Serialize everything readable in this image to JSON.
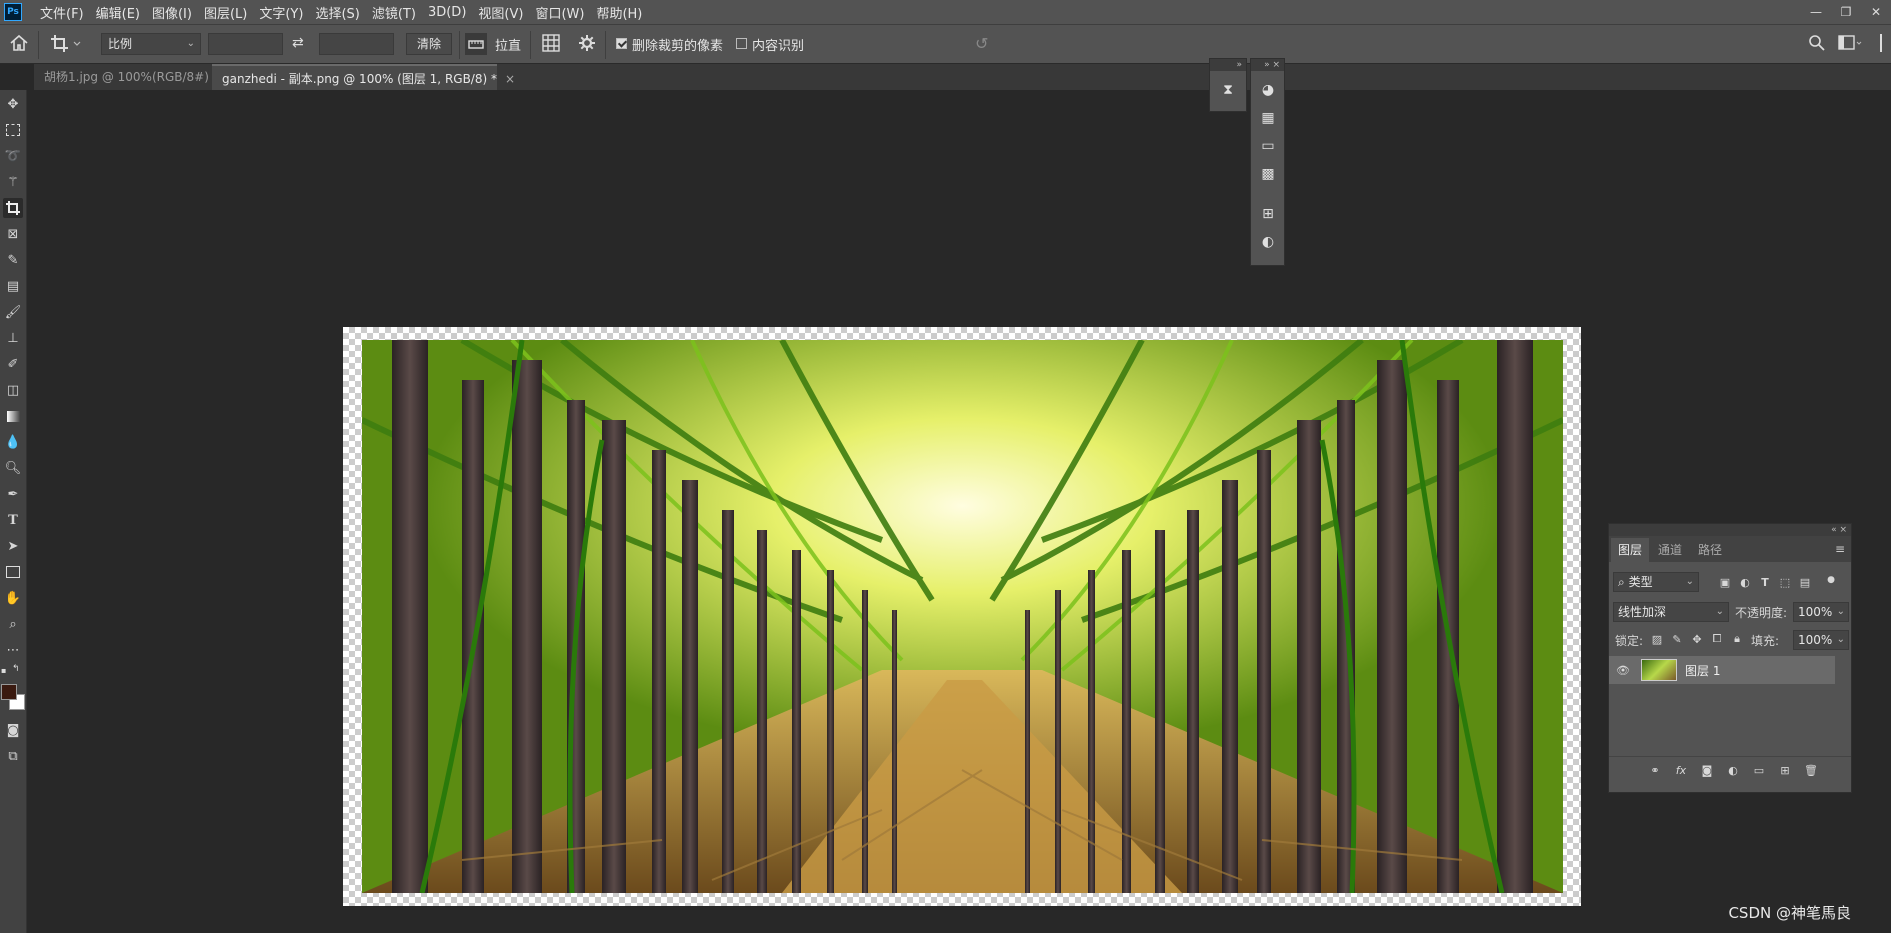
{
  "app": {
    "logo": "Ps"
  },
  "menu": [
    "文件(F)",
    "编辑(E)",
    "图像(I)",
    "图层(L)",
    "文字(Y)",
    "选择(S)",
    "滤镜(T)",
    "3D(D)",
    "视图(V)",
    "窗口(W)",
    "帮助(H)"
  ],
  "window_controls": {
    "minimize": "—",
    "restore": "❐",
    "close": "✕"
  },
  "options": {
    "ratio_value": "比例",
    "width_value": "",
    "height_value": "",
    "clear_label": "清除",
    "straighten_label": "拉直",
    "delete_cropped_label": "删除裁剪的像素",
    "delete_cropped_checked": true,
    "content_aware_label": "内容识别",
    "content_aware_checked": false
  },
  "tabs": [
    {
      "label": "胡杨1.jpg @ 100%(RGB/8#)",
      "active": false
    },
    {
      "label": "ganzhedi - 副本.png @ 100% (图层 1, RGB/8) *",
      "active": true
    }
  ],
  "tools": [
    "move-icon",
    "marquee-icon",
    "lasso-icon",
    "magic-wand-icon",
    "crop-icon",
    "frame-icon",
    "eyedropper-icon",
    "healing-icon",
    "brush-icon",
    "stamp-icon",
    "history-brush-icon",
    "eraser-icon",
    "gradient-icon",
    "blur-icon",
    "dodge-icon",
    "pen-icon",
    "type-icon",
    "path-select-icon",
    "rectangle-icon",
    "hand-icon",
    "zoom-icon",
    "more-icon"
  ],
  "colors": {
    "foreground": "#3a1a10",
    "background": "#ffffff",
    "accent": "#31a8ff"
  },
  "layers_panel": {
    "tabs": [
      "图层",
      "通道",
      "路径"
    ],
    "filter_kind": "类型",
    "blend_mode": "线性加深",
    "opacity_label": "不透明度:",
    "opacity_value": "100%",
    "lock_label": "锁定:",
    "fill_label": "填充:",
    "fill_value": "100%",
    "layers": [
      {
        "name": "图层 1",
        "visible": true
      }
    ]
  },
  "watermark": "CSDN @神笔馬良"
}
